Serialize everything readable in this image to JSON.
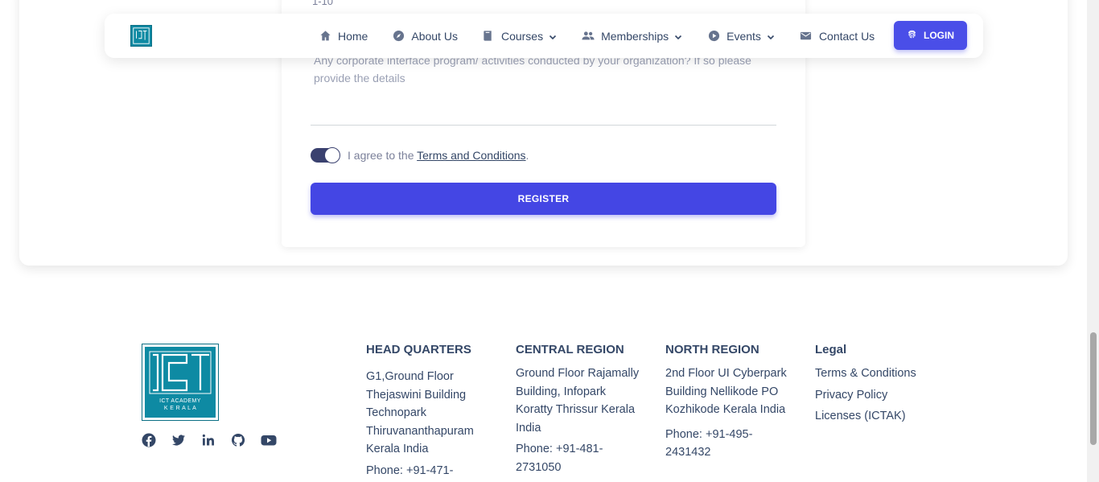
{
  "form": {
    "overflow_text": "1-10",
    "textarea_placeholder": "Any corporate interface program/ activities conducted by your organization? If so please provide the details",
    "agree_prefix": "I agree to the ",
    "terms_link": "Terms and Conditions",
    "agree_suffix": ".",
    "toggle_on": true,
    "register_label": "REGISTER"
  },
  "navbar": {
    "logo_text": "ICT",
    "items": [
      {
        "label": "Home",
        "icon": "home-icon",
        "dropdown": false
      },
      {
        "label": "About Us",
        "icon": "explore-icon",
        "dropdown": false
      },
      {
        "label": "Courses",
        "icon": "book-icon",
        "dropdown": true
      },
      {
        "label": "Memberships",
        "icon": "people-icon",
        "dropdown": true
      },
      {
        "label": "Events",
        "icon": "play-circle-icon",
        "dropdown": true
      },
      {
        "label": "Contact Us",
        "icon": "mail-icon",
        "dropdown": false
      }
    ],
    "login_label": "LOGIN"
  },
  "footer": {
    "logo_line1": "ICT ACADEMY",
    "logo_line2": "K E R A L A",
    "social": [
      "facebook-icon",
      "twitter-icon",
      "linkedin-icon",
      "github-icon",
      "youtube-icon"
    ],
    "head_quarters": {
      "title": "HEAD QUARTERS",
      "address": [
        "G1,Ground Floor",
        "Thejaswini Building",
        "Technopark",
        "Thiruvananthapuram",
        "Kerala India"
      ],
      "phone": "Phone: +91-471-"
    },
    "central_region": {
      "title": "CENTRAL REGION",
      "address": [
        "Ground Floor Rajamally",
        "Building, Infopark",
        "Koratty Thrissur Kerala",
        "India"
      ],
      "phone": [
        "Phone: +91-481-",
        "2731050"
      ]
    },
    "north_region": {
      "title": "NORTH REGION",
      "address": [
        "2nd Floor UI Cyberpark",
        "Building Nellikode PO",
        "Kozhikode Kerala India"
      ],
      "phone": [
        "Phone: +91-495-",
        "2431432"
      ]
    },
    "legal": {
      "title": "Legal",
      "links": [
        "Terms & Conditions",
        "Privacy Policy",
        "Licenses (ICTAK)"
      ]
    }
  },
  "colors": {
    "primary": "#4446e4",
    "text": "#344767",
    "muted": "#7b809a",
    "logo_teal": "#0e8aa3",
    "toggle": "#3a416f"
  }
}
